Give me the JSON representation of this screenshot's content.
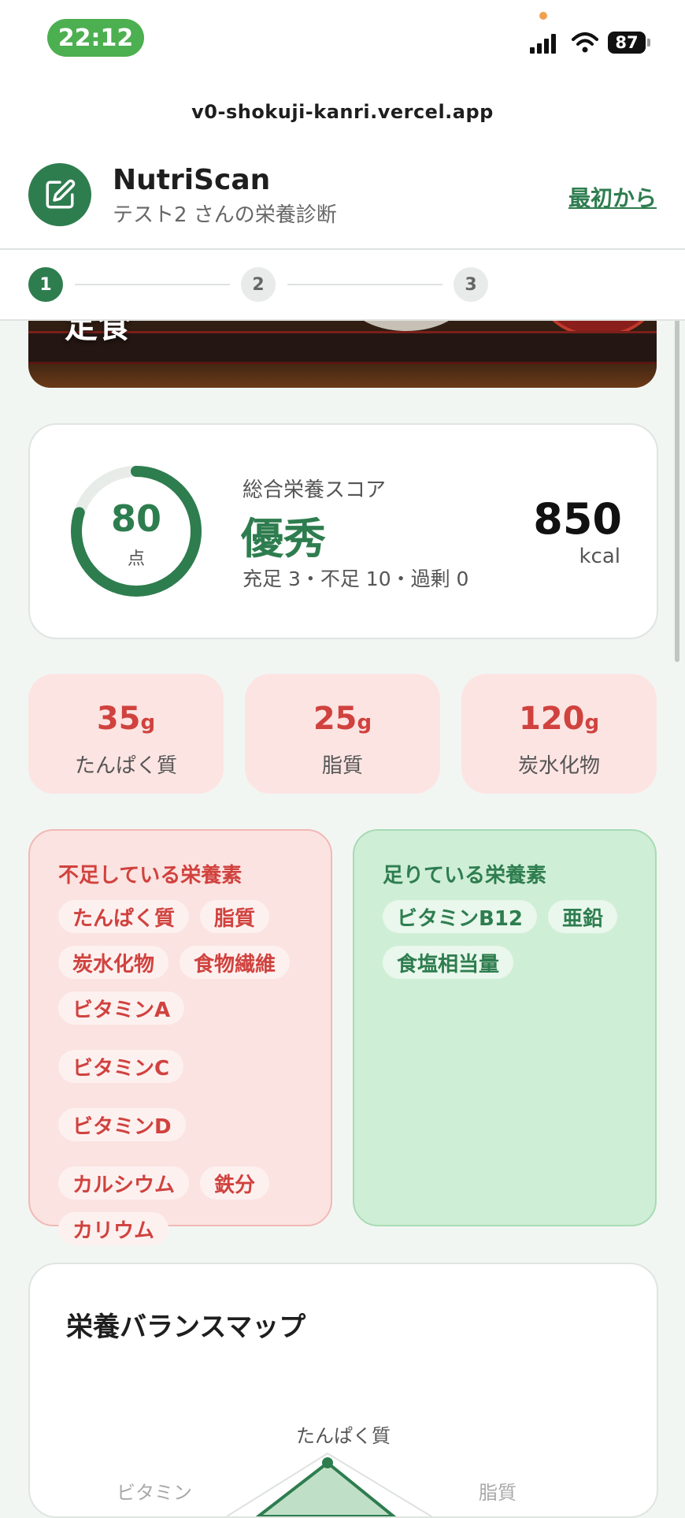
{
  "status_bar": {
    "time": "22:12",
    "battery": "87"
  },
  "browser": {
    "url": "v0-shokuji-kanri.vercel.app"
  },
  "header": {
    "app_name": "NutriScan",
    "subtitle": "テスト2 さんの栄養診断",
    "restart_label": "最初から",
    "logo_icon": "edit-icon",
    "accent_color": "#2e7d4f"
  },
  "stepper": {
    "steps": [
      "1",
      "2",
      "3"
    ],
    "active_step": 1
  },
  "meal_image": {
    "caption": "定食"
  },
  "score": {
    "label": "総合栄養スコア",
    "value": "80",
    "unit": "点",
    "value_fraction": 0.8,
    "grade": "優秀",
    "breakdown": "充足 3・不足 10・過剰 0",
    "kcal": "850",
    "kcal_unit": "kcal"
  },
  "macros": [
    {
      "value": "35",
      "unit": "g",
      "name": "たんぱく質"
    },
    {
      "value": "25",
      "unit": "g",
      "name": "脂質"
    },
    {
      "value": "120",
      "unit": "g",
      "name": "炭水化物"
    }
  ],
  "deficient": {
    "title": "不足している栄養素",
    "color": "#d0423e",
    "items": [
      "たんぱく質",
      "脂質",
      "炭水化物",
      "食物繊維",
      "ビタミンA",
      "ビタミンC",
      "ビタミンD",
      "カルシウム",
      "鉄分",
      "カリウム"
    ]
  },
  "sufficient": {
    "title": "足りている栄養素",
    "items": [
      "ビタミンB12",
      "亜鉛",
      "食塩相当量"
    ]
  },
  "balance_map": {
    "title": "栄養バランスマップ",
    "labels": [
      "たんぱく質",
      "ビタミン",
      "脂質"
    ]
  }
}
